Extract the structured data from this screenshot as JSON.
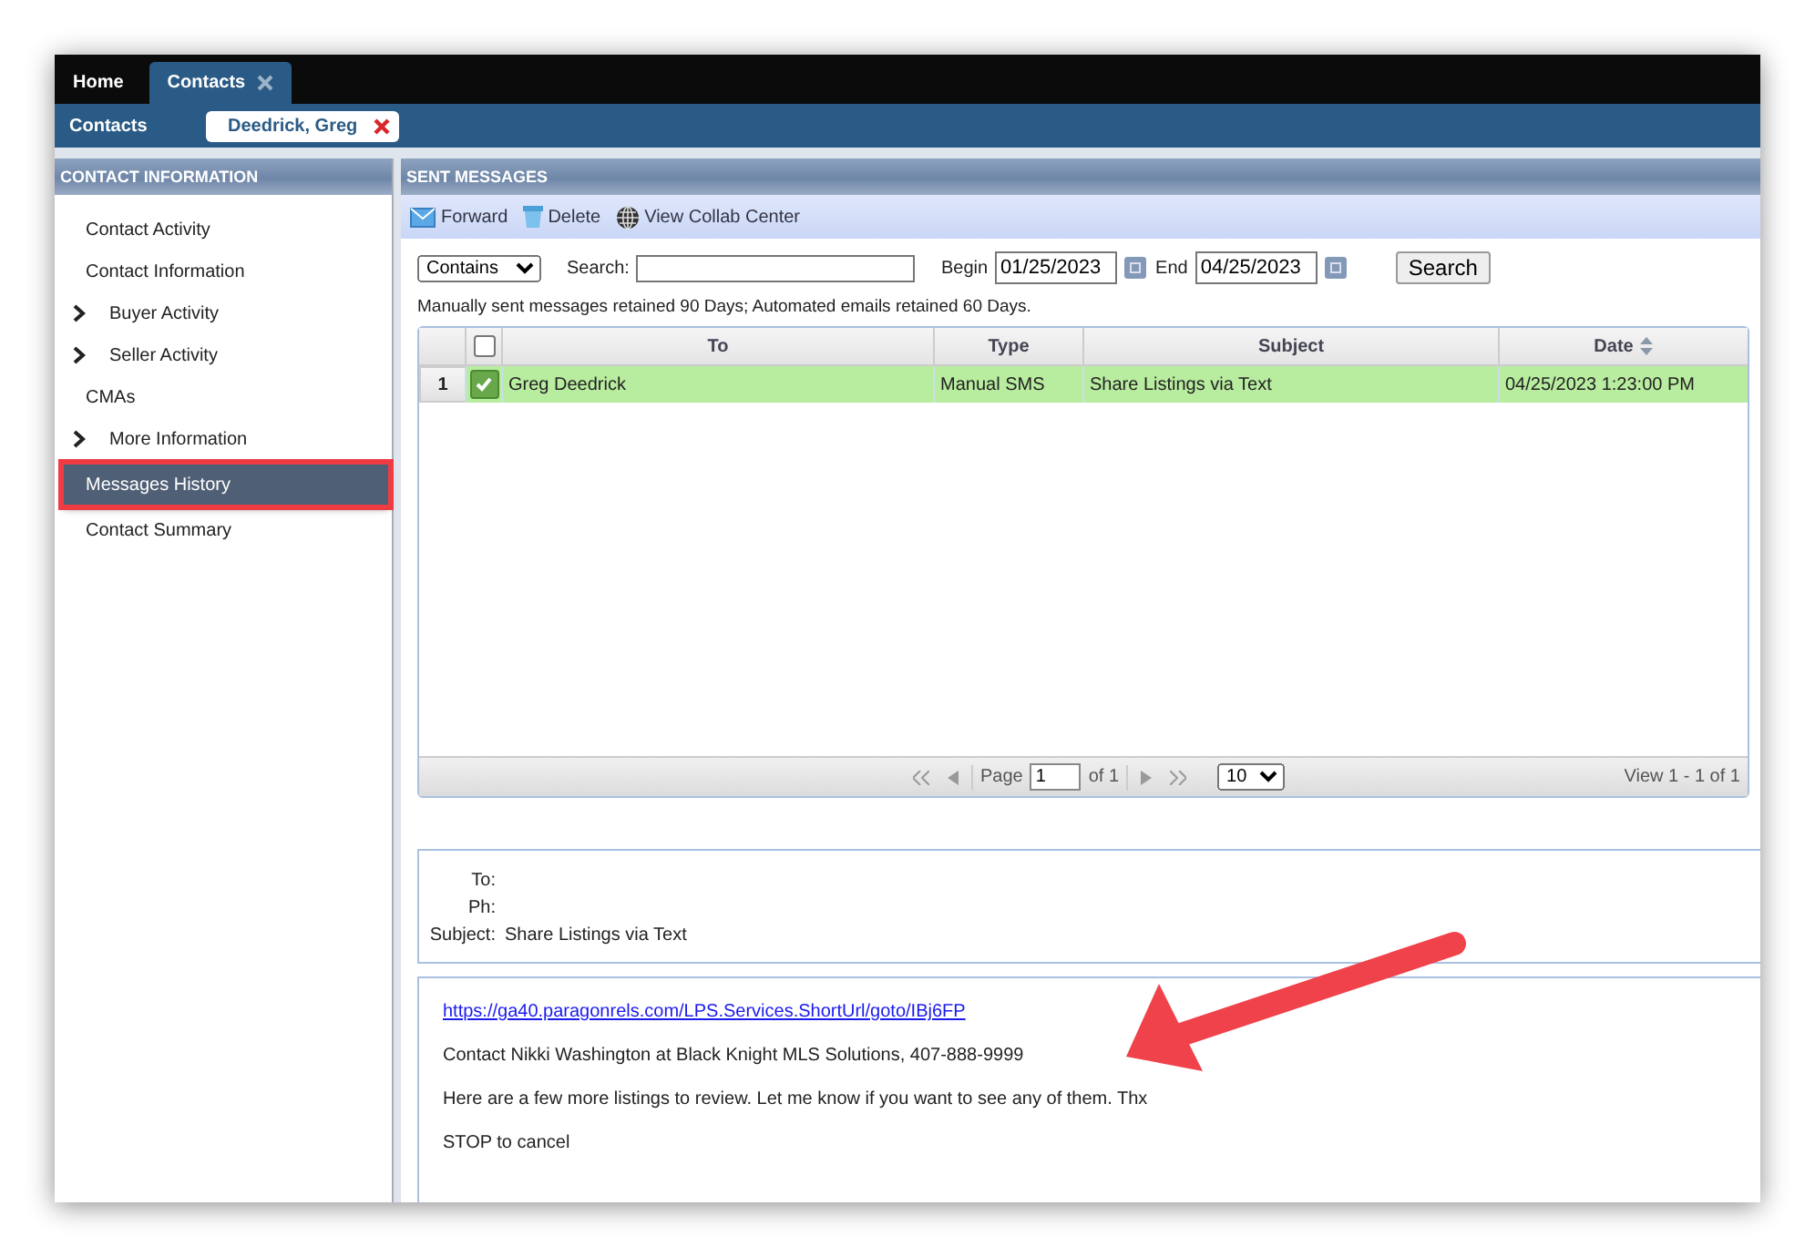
{
  "top_tabs": [
    {
      "label": "Home",
      "selected": false,
      "closable": false
    },
    {
      "label": "Contacts",
      "selected": true,
      "closable": true
    }
  ],
  "sub_bar": {
    "label": "Contacts",
    "chip": "Deedrick, Greg"
  },
  "sidebar": {
    "title": "CONTACT INFORMATION",
    "items": [
      {
        "label": "Contact Activity",
        "expandable": false,
        "selected": false,
        "highlighted": false
      },
      {
        "label": "Contact Information",
        "expandable": false,
        "selected": false,
        "highlighted": false
      },
      {
        "label": "Buyer Activity",
        "expandable": true,
        "selected": false,
        "highlighted": false
      },
      {
        "label": "Seller Activity",
        "expandable": true,
        "selected": false,
        "highlighted": false
      },
      {
        "label": "CMAs",
        "expandable": false,
        "selected": false,
        "highlighted": false
      },
      {
        "label": "More Information",
        "expandable": true,
        "selected": false,
        "highlighted": false
      },
      {
        "label": "Messages History",
        "expandable": false,
        "selected": true,
        "highlighted": true
      },
      {
        "label": "Contact Summary",
        "expandable": false,
        "selected": false,
        "highlighted": false
      }
    ]
  },
  "main": {
    "title": "SENT MESSAGES",
    "toolbar": [
      {
        "label": "Forward",
        "kind": "envelope"
      },
      {
        "label": "Delete",
        "kind": "bin"
      },
      {
        "label": "View Collab Center",
        "kind": "globe"
      }
    ],
    "filter": {
      "mode": "Contains",
      "search_label": "Search:",
      "begin_label": "Begin",
      "begin": "01/25/2023",
      "end_label": "End",
      "end": "04/25/2023",
      "search_button": "Search"
    },
    "note": "Manually sent messages retained 90 Days; Automated emails retained 60 Days.",
    "table": {
      "header_checked": false,
      "columns": [
        {
          "label": "To",
          "sortable": false
        },
        {
          "label": "Type",
          "sortable": false
        },
        {
          "label": "Subject",
          "sortable": false
        },
        {
          "label": "Date",
          "sortable": true
        }
      ],
      "rows": [
        {
          "number": "1",
          "checked": true,
          "selected": true,
          "cells": [
            "Greg Deedrick",
            "Manual SMS",
            "Share Listings via Text",
            "04/25/2023 1:23:00 PM"
          ]
        }
      ]
    },
    "pager": {
      "page_label": "Page",
      "page": "1",
      "of": "of 1",
      "page_size": "10",
      "view": "View 1 - 1 of 1"
    },
    "detail": {
      "fields": [
        {
          "label": "To:"
        },
        {
          "label": "Ph:"
        },
        {
          "label": "Subject:",
          "value": "Share Listings via Text"
        }
      ]
    },
    "body": {
      "link": "https://ga40.paragonrels.com/LPS.Services.ShortUrl/goto/IBj6FP",
      "paragraphs": [
        "Contact Nikki Washington at Black Knight MLS Solutions, 407-888-9999",
        "Here are a few more listings to review. Let me know if you want to see any of them. Thx",
        "STOP to cancel"
      ]
    }
  }
}
